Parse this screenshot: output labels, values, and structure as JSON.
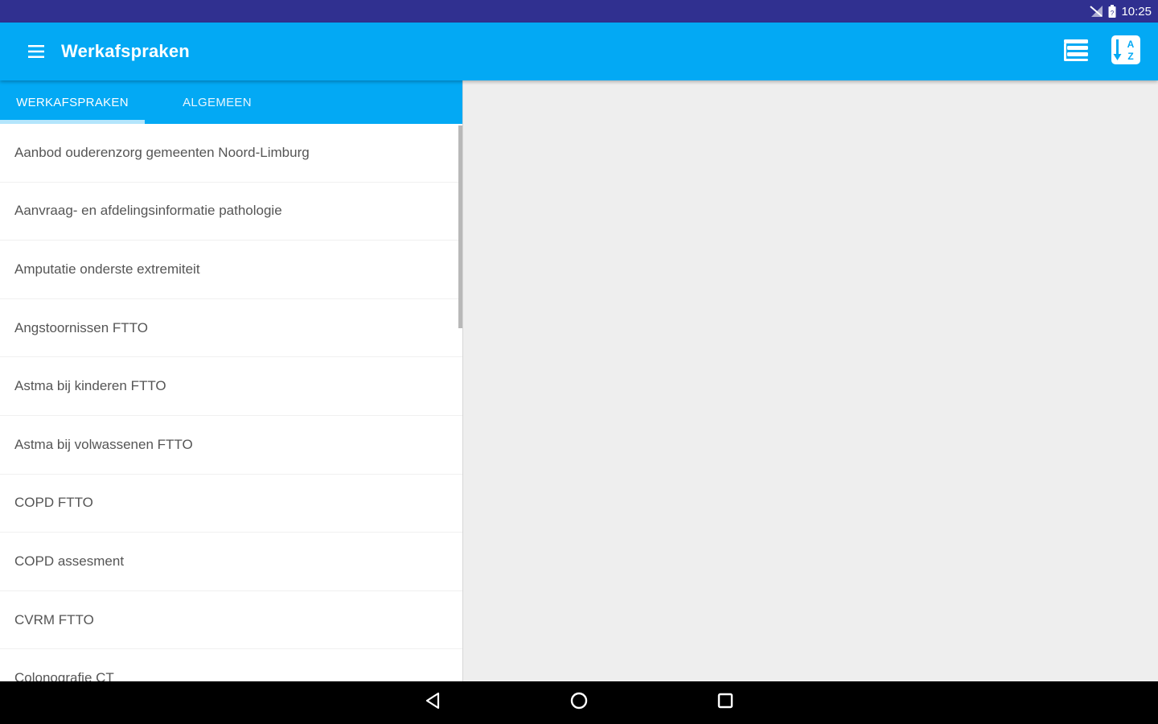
{
  "status_bar": {
    "time": "10:25",
    "icons": [
      "signal-off-icon",
      "battery-icon"
    ]
  },
  "app_bar": {
    "title": "Werkafspraken",
    "menu_icon": "hamburger-menu-icon",
    "actions": [
      {
        "icon": "list-view-icon"
      },
      {
        "icon": "sort-az-icon"
      }
    ],
    "color": "#03a9f4"
  },
  "tabs": {
    "items": [
      {
        "label": "WERKAFSPRAKEN",
        "selected": true
      },
      {
        "label": "ALGEMEEN",
        "selected": false
      }
    ]
  },
  "list": {
    "items": [
      "Aanbod ouderenzorg gemeenten Noord-Limburg",
      "Aanvraag- en afdelingsinformatie pathologie",
      "Amputatie onderste extremiteit",
      "Angstoornissen FTTO",
      "Astma bij kinderen FTTO",
      "Astma bij volwassenen FTTO",
      "COPD FTTO",
      "COPD assesment",
      "CVRM FTTO",
      "Colonografie CT"
    ]
  },
  "nav_bar": {
    "buttons": [
      "back-icon",
      "home-icon",
      "recents-icon"
    ]
  },
  "colors": {
    "status_bar": "#303090",
    "primary": "#03a9f4",
    "background": "#eeeeee"
  }
}
